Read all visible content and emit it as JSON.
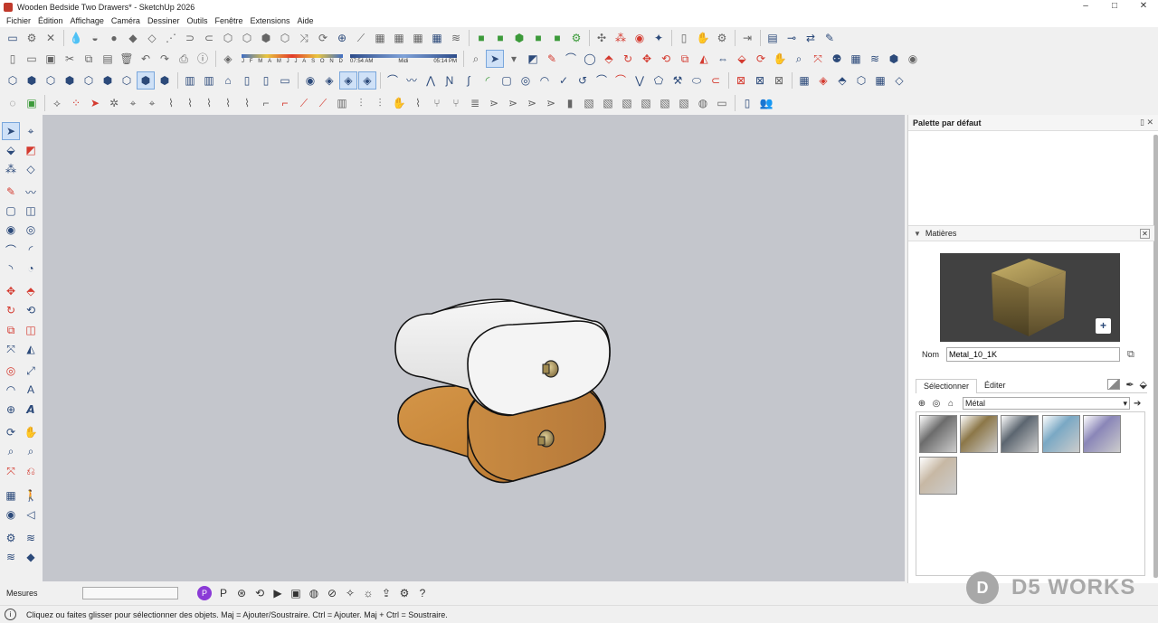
{
  "app": {
    "title": "Wooden Bedside Two Drawers* - SketchUp 2026"
  },
  "window_controls": {
    "minimize": "–",
    "maximize": "□",
    "close": "✕"
  },
  "menu": [
    "Fichier",
    "Édition",
    "Affichage",
    "Caméra",
    "Dessiner",
    "Outils",
    "Fenêtre",
    "Extensions",
    "Aide"
  ],
  "shadows": {
    "months": [
      "J",
      "F",
      "M",
      "A",
      "M",
      "J",
      "J",
      "A",
      "S",
      "O",
      "N",
      "D"
    ],
    "time_start": "07:54 AM",
    "time_mid": "Midi",
    "time_end": "05:14 PM"
  },
  "tray": {
    "title": "Palette par défaut",
    "materials_panel": {
      "title": "Matières",
      "name_label": "Nom",
      "material_name": "Metal_10_1K",
      "tabs": [
        "Sélectionner",
        "Éditer"
      ],
      "active_tab": "Sélectionner",
      "library": "Métal",
      "swatch_colors": [
        "#6c6c6c",
        "#8c7748",
        "#5c6670",
        "#7aa8c4",
        "#8a86b8",
        "#c7b8a4"
      ]
    }
  },
  "status": {
    "measure_label": "Mesures",
    "measure_value": "",
    "hint": "Cliquez ou faites glisser pour sélectionner des objets. Maj = Ajouter/Soustraire. Ctrl = Ajouter. Maj + Ctrl = Soustraire."
  },
  "watermark": {
    "logo": "D",
    "text": "D5 WORKS"
  },
  "colors": {
    "viewport_bg": "#c4c6cc",
    "accent": "#2c4a7a",
    "wood": "#c8873a",
    "drawer_white": "#f2f2f2"
  }
}
